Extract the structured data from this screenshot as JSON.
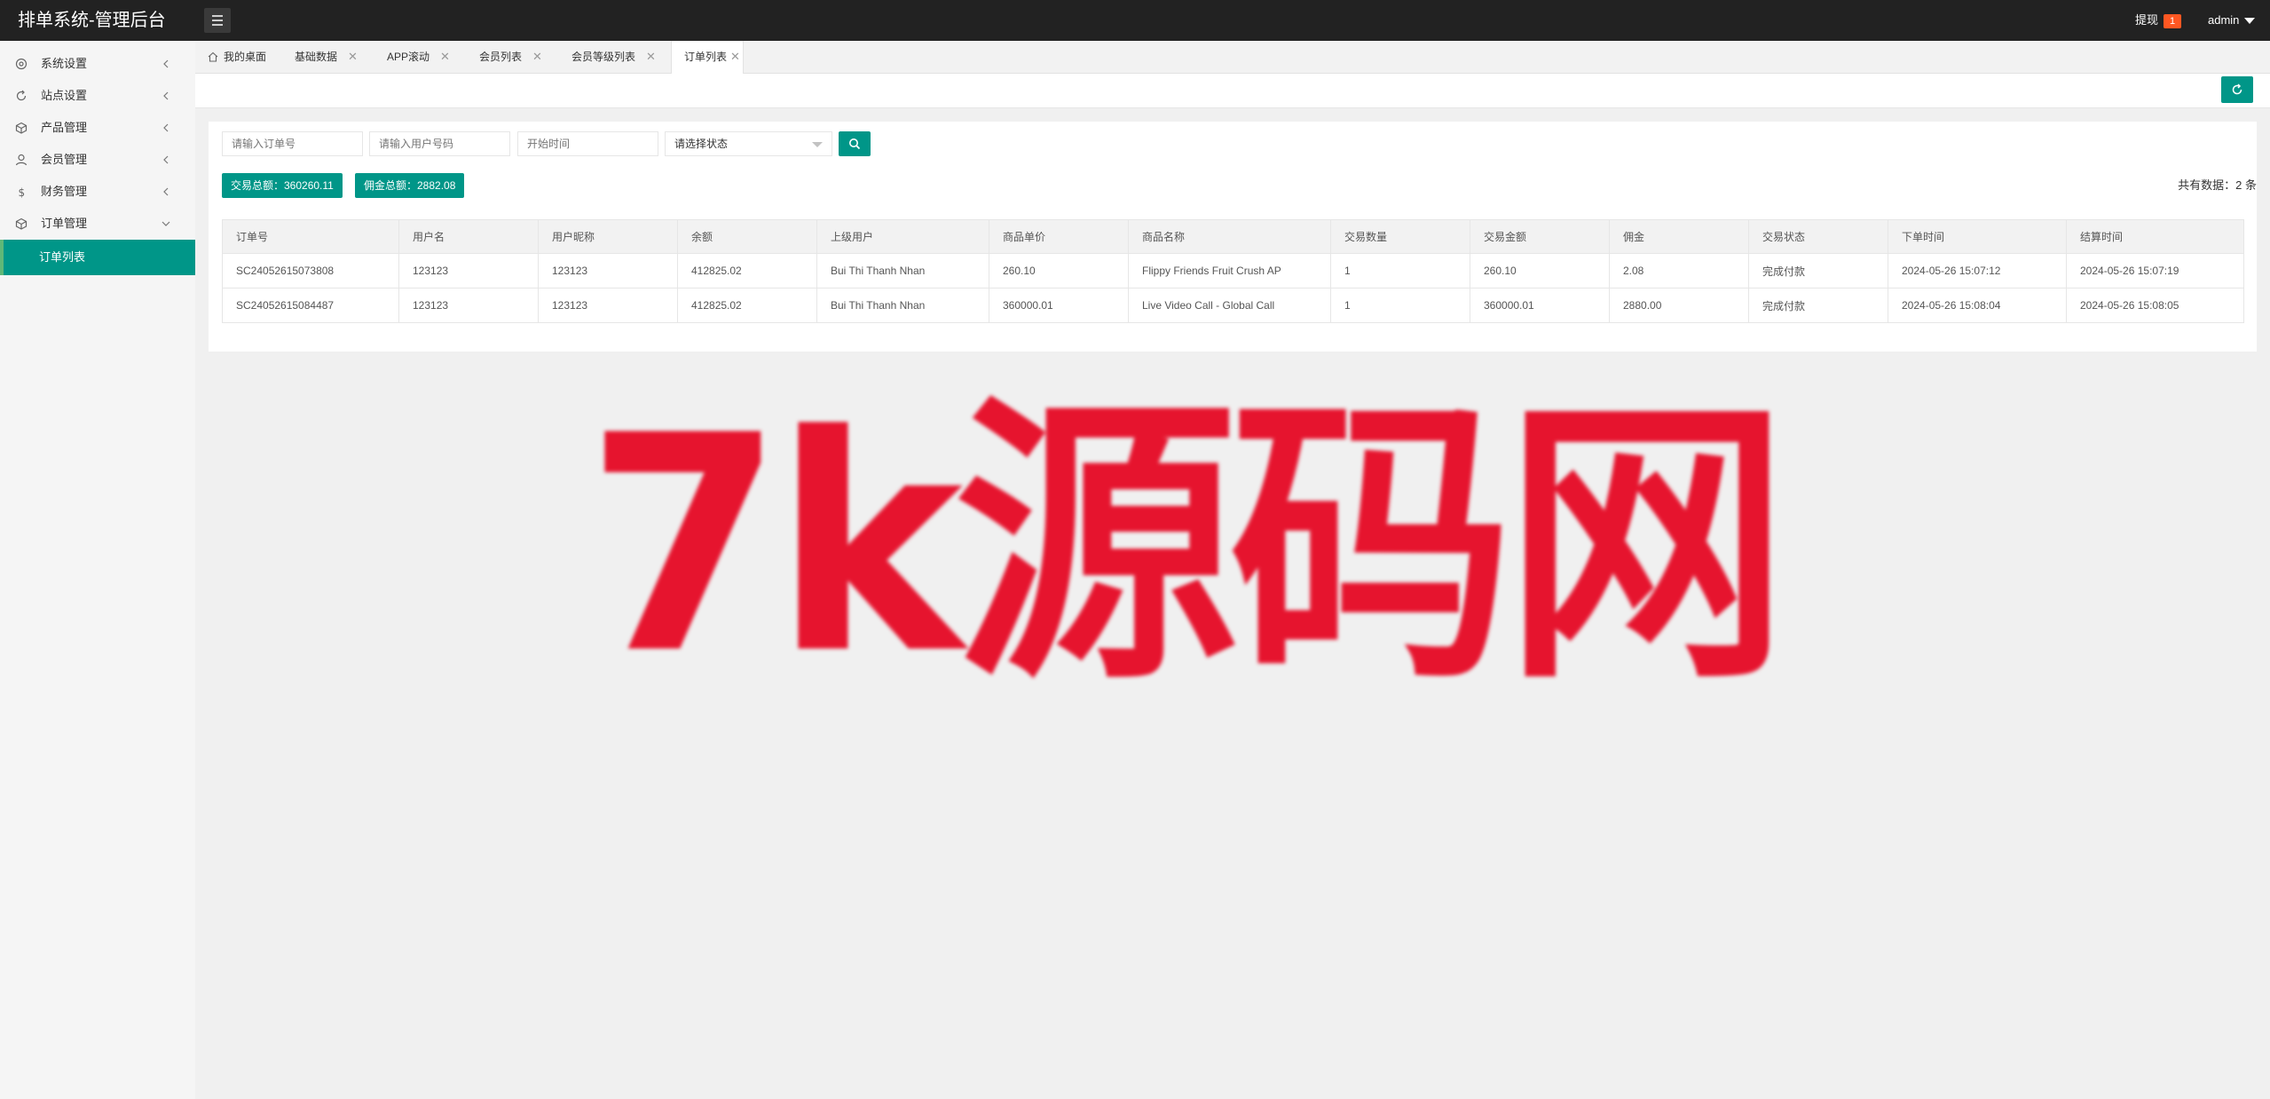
{
  "header": {
    "app_title": "排单系统-管理后台",
    "withdraw_label": "提现",
    "withdraw_badge": "1",
    "user_name": "admin"
  },
  "sidebar": {
    "items": [
      {
        "label": "系统设置",
        "icon": "gear-icon"
      },
      {
        "label": "站点设置",
        "icon": "refresh-icon"
      },
      {
        "label": "产品管理",
        "icon": "cube-icon"
      },
      {
        "label": "会员管理",
        "icon": "user-icon"
      },
      {
        "label": "财务管理",
        "icon": "dollar-icon"
      },
      {
        "label": "订单管理",
        "icon": "cube-icon",
        "expanded": true
      }
    ],
    "sub_items": [
      {
        "label": "订单列表",
        "active": true
      }
    ]
  },
  "tabs": [
    {
      "label": "我的桌面",
      "closable": false
    },
    {
      "label": "基础数据",
      "closable": true
    },
    {
      "label": "APP滚动",
      "closable": true
    },
    {
      "label": "会员列表",
      "closable": true
    },
    {
      "label": "会员等级列表",
      "closable": true
    },
    {
      "label": "订单列表",
      "closable": true,
      "active": true
    }
  ],
  "filters": {
    "order_no_placeholder": "请输入订单号",
    "user_no_placeholder": "请输入用户号码",
    "start_time_placeholder": "开始时间",
    "status_selected": "请选择状态"
  },
  "stats": {
    "trade_total": "交易总额：360260.11",
    "commission_total": "佣金总额：2882.08",
    "record_count": "共有数据：2 条"
  },
  "table": {
    "columns": [
      "订单号",
      "用户名",
      "用户昵称",
      "余额",
      "上级用户",
      "商品单价",
      "商品名称",
      "交易数量",
      "交易金额",
      "佣金",
      "交易状态",
      "下单时间",
      "结算时间"
    ],
    "rows": [
      [
        "SC24052615073808",
        "123123",
        "123123",
        "412825.02",
        "Bui Thi Thanh Nhan",
        "260.10",
        "Flippy Friends Fruit Crush AP",
        "1",
        "260.10",
        "2.08",
        "完成付款",
        "2024-05-26 15:07:12",
        "2024-05-26 15:07:19"
      ],
      [
        "SC24052615084487",
        "123123",
        "123123",
        "412825.02",
        "Bui Thi Thanh Nhan",
        "360000.01",
        "Live Video Call - Global Call",
        "1",
        "360000.01",
        "2880.00",
        "完成付款",
        "2024-05-26 15:08:04",
        "2024-05-26 15:08:05"
      ]
    ]
  },
  "watermark": "7k源码网",
  "colors": {
    "accent": "#009688",
    "topbar": "#222222",
    "badge": "#ff5722",
    "watermark": "#e6142e"
  }
}
